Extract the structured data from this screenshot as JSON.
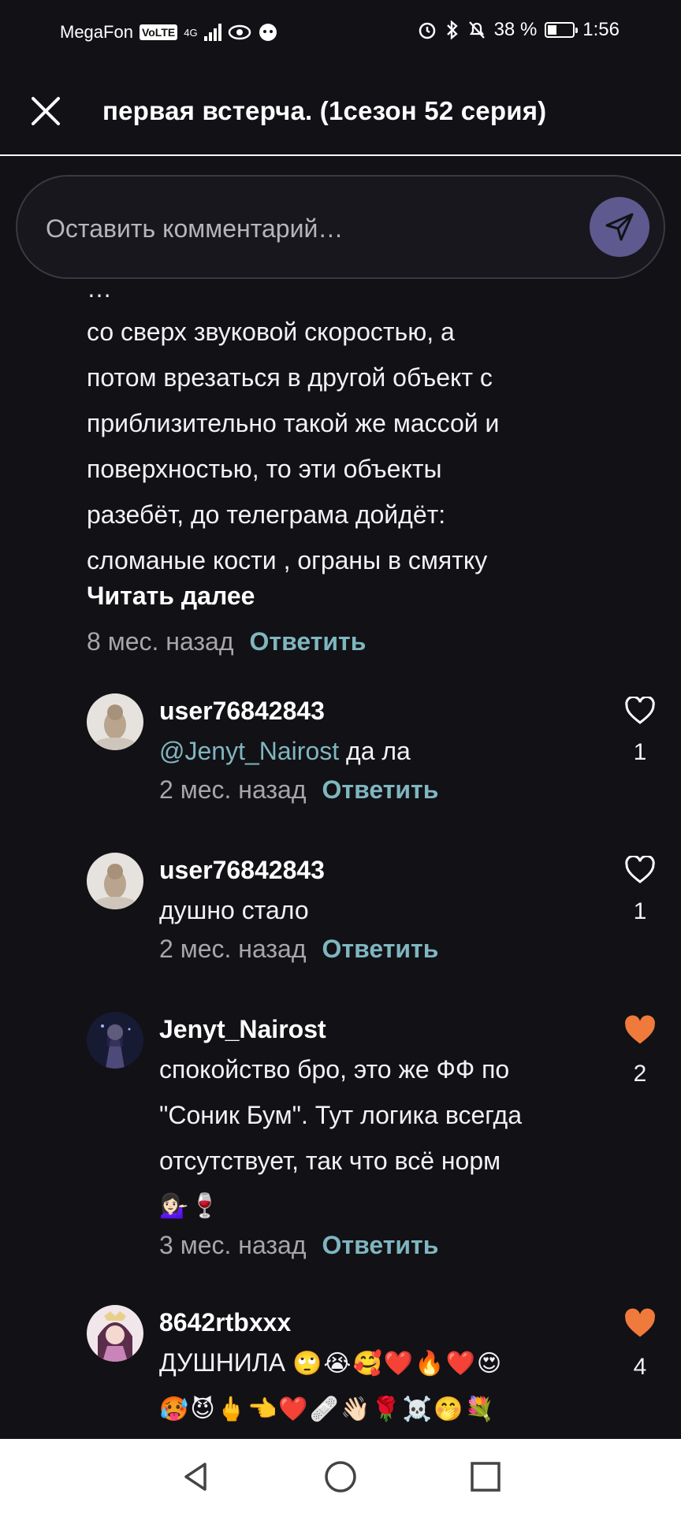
{
  "status_bar": {
    "carrier": "MegaFon",
    "volte": "VoLTE",
    "network": "4G",
    "battery_pct": "38 %",
    "battery_level": 0.38,
    "time": "1:56"
  },
  "header": {
    "title": "первая встерча. (1сезон 52 серия)"
  },
  "comment_input": {
    "placeholder": "Оставить комментарий…"
  },
  "parent_comment": {
    "cut_line": "…",
    "lines": [
      "со сверх звуковой скоростью, а",
      "потом врезаться в другой объект с",
      "приблизительно такой же массой и",
      "поверхностью, то  эти объекты",
      "разебёт, до телеграма дойдёт:",
      "сломаные кости , ограны в смятку"
    ],
    "read_more": "Читать далее",
    "time": "8 мес. назад",
    "reply_label": "Ответить"
  },
  "replies": [
    {
      "username": "user76842843",
      "mention": "@Jenyt_Nairost",
      "text": " да ла",
      "time": "2 мес. назад",
      "reply_label": "Ответить",
      "likes": "1",
      "liked": false
    },
    {
      "username": "user76842843",
      "text": "душно стало",
      "time": "2 мес. назад",
      "reply_label": "Ответить",
      "likes": "1",
      "liked": false
    },
    {
      "username": "Jenyt_Nairost",
      "text_lines": [
        "спокойство бро, это же ФФ по",
        "\"Соник Бум\". Тут логика всегда",
        "отсутствует, так что всё норм"
      ],
      "emoji_line": "💁🏻‍♀️🍷",
      "time": "3 мес. назад",
      "reply_label": "Ответить",
      "likes": "2",
      "liked": true
    },
    {
      "username": "8642rtbxxx",
      "text": "ДУШНИЛА",
      "emoji_inline": "🙄😭🥰❤️🔥❤️😍",
      "emoji_line": "🥵😈🖕👈❤️🩹👋🏻🌹☠️🤭💐",
      "likes": "4",
      "liked": true
    }
  ],
  "colors": {
    "background": "#121116",
    "accent_link": "#7fb6bf",
    "like_active": "#f07a3b",
    "send_button": "#5e5a8f"
  }
}
